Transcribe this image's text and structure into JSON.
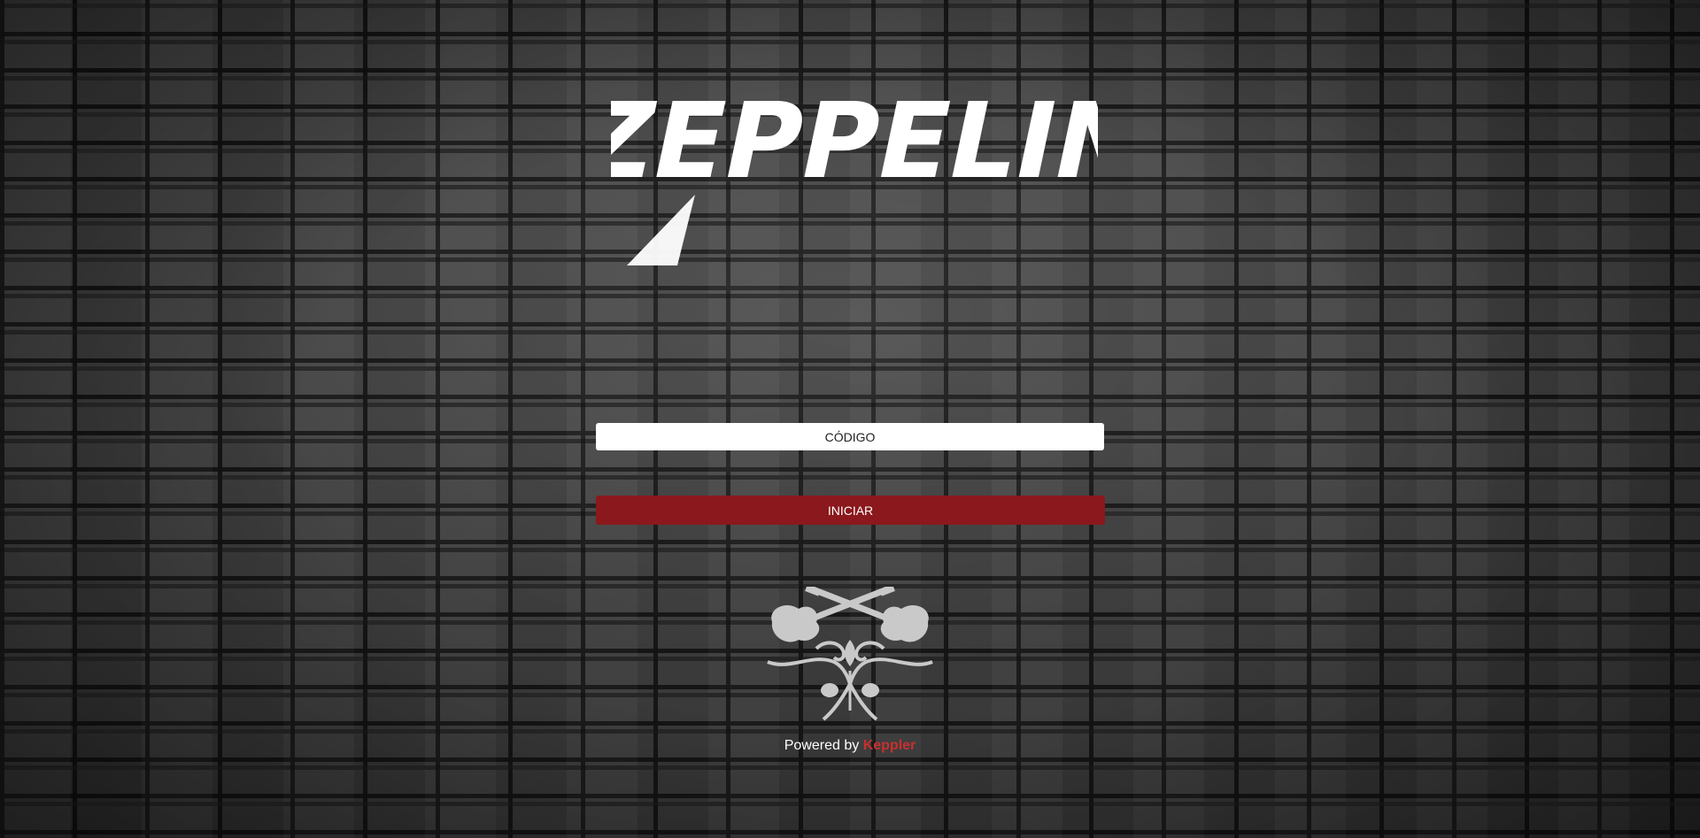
{
  "brand": {
    "logo_text": "ZEPPELIN"
  },
  "login": {
    "code_placeholder": "CÓDIGO",
    "submit_label": "INICIAR"
  },
  "footer": {
    "powered_prefix": "Powered by",
    "powered_brand": "Keppler"
  },
  "colors": {
    "accent": "#8b181c",
    "brand_link": "#c8302f"
  },
  "icons": {
    "emblem": "crossed-guitars-emblem-icon"
  }
}
